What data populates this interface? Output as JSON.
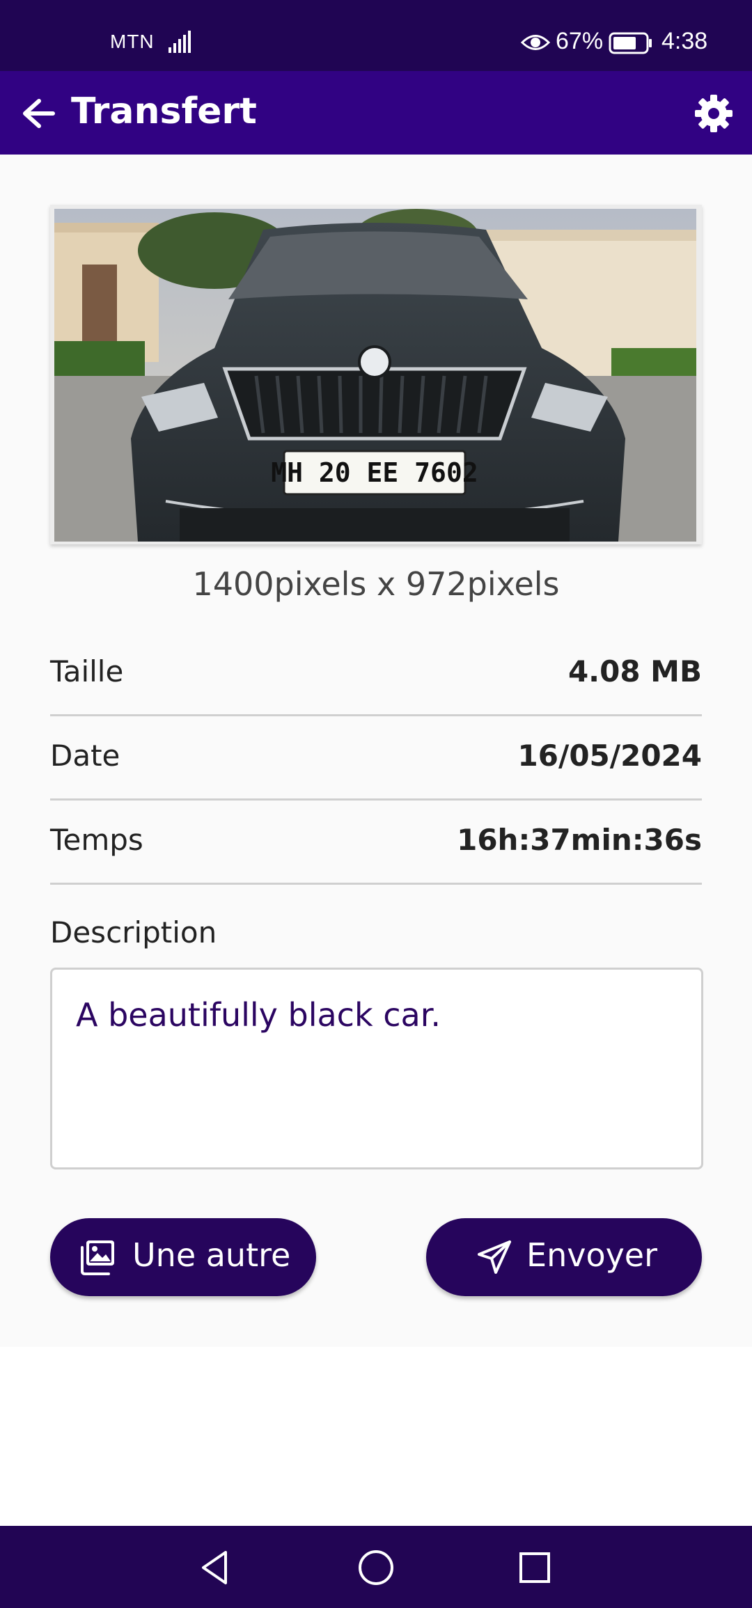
{
  "status_bar": {
    "carrier": "MTN",
    "battery": "67%",
    "time": "4:38",
    "signal_icon": "signal-icon",
    "eye_icon": "eye-icon",
    "battery_icon": "battery-icon"
  },
  "app_bar": {
    "title": "Transfert",
    "back_icon": "arrow-left-icon",
    "settings_icon": "gear-icon"
  },
  "image": {
    "description": "photo of dark grey car front",
    "plate_text": "MH 20 EE 7602",
    "dimensions": "1400pixels x 972pixels"
  },
  "details": [
    {
      "label": "Taille",
      "value": "4.08 MB"
    },
    {
      "label": "Date",
      "value": "16/05/2024"
    },
    {
      "label": "Temps",
      "value": "16h:37min:36s"
    }
  ],
  "description": {
    "label": "Description",
    "value": "A beautifully black car."
  },
  "buttons": {
    "another": "Une autre",
    "send": "Envoyer"
  },
  "colors": {
    "status_bar": "#200553",
    "app_bar": "#310283",
    "button": "#26055c",
    "description_text": "#2b0561"
  }
}
